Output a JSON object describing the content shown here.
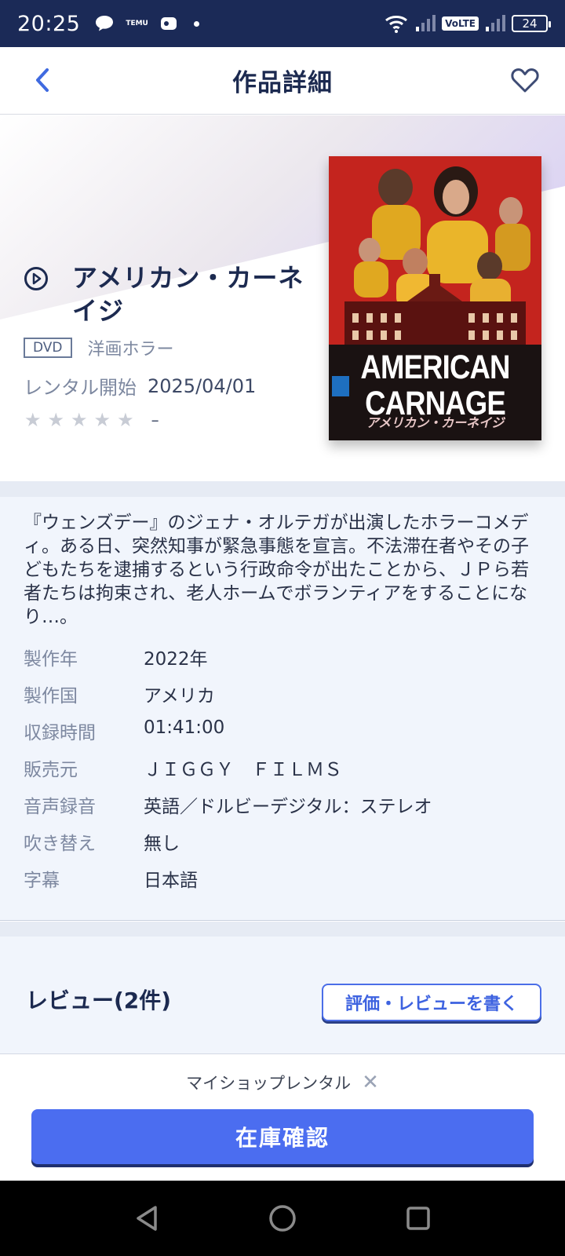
{
  "status_bar": {
    "time": "20:25",
    "temu_label": "TEMU",
    "volte": "VoLTE",
    "battery": "24"
  },
  "header": {
    "title": "作品詳細"
  },
  "product": {
    "title": "アメリカン・カーネイジ",
    "format_badge": "DVD",
    "genre": "洋画ホラー",
    "rental_label": "レンタル開始",
    "rental_date": "2025/04/01",
    "rating_value": "–",
    "stars_total": 5,
    "poster": {
      "title_line1": "AMERICAN",
      "title_line2": "CARNAGE",
      "subtitle": "アメリカン・カーネイジ"
    }
  },
  "details": {
    "description": "『ウェンズデー』のジェナ・オルテガが出演したホラーコメディ。ある日、突然知事が緊急事態を宣言。不法滞在者やその子どもたちを逮捕するという行政命令が出たことから、ＪＰら若者たちは拘束され、老人ホームでボランティアをすることになり…。",
    "specs": [
      {
        "label": "製作年",
        "value": "2022年"
      },
      {
        "label": "製作国",
        "value": "アメリカ"
      },
      {
        "label": "収録時間",
        "value": "01:41:00"
      },
      {
        "label": "販売元",
        "value": "ＪＩＧＧＹ　ＦＩＬＭＳ"
      },
      {
        "label": "音声録音",
        "value": "英語／ドルビーデジタル：ステレオ"
      },
      {
        "label": "吹き替え",
        "value": "無し"
      },
      {
        "label": "字幕",
        "value": "日本語"
      }
    ]
  },
  "reviews": {
    "title": "レビュー(2件)",
    "write_button": "評価・レビューを書く"
  },
  "bottom": {
    "myshop_label": "マイショップレンタル",
    "myshop_close": "✕",
    "stock_button": "在庫確認"
  },
  "colors": {
    "status_bar": "#1b2a57",
    "accent": "#4b6df0",
    "title_text": "#1c2a50",
    "muted_text": "#7d88a0",
    "poster_red": "#c4241e"
  }
}
